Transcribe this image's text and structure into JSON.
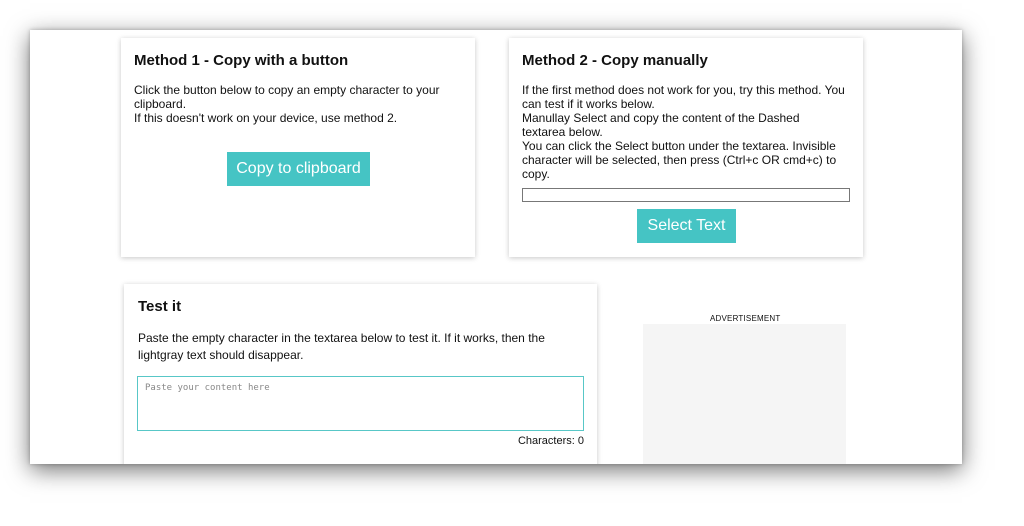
{
  "method1": {
    "title": "Method 1 - Copy with a button",
    "line1": "Click the button below to copy an empty character to your",
    "line2": "clipboard.",
    "line3": "If this doesn't work on your device, use method 2.",
    "button_label": "Copy to clipboard"
  },
  "method2": {
    "title": "Method 2 - Copy manually",
    "lines": [
      "If the first method does not work for you, try this method. You",
      "can test if it works below.",
      "Manullay Select and copy the content of the Dashed",
      "textarea below.",
      "You can click the Select button under the textarea. Invisible",
      "character will be selected, then press (Ctrl+c OR cmd+c) to",
      "copy."
    ],
    "button_label": "Select Text"
  },
  "test": {
    "title": "Test it",
    "line1": "Paste the empty character in the textarea below to test it. If it works, then the",
    "line2": "lightgray text should disappear.",
    "placeholder": "Paste your content here",
    "char_label": "Characters: 0"
  },
  "ad": {
    "label": "ADVERTISEMENT"
  },
  "colors": {
    "accent": "#45c4c4",
    "textarea_border": "#58c7c7",
    "ad_background": "#f5f5f5"
  }
}
